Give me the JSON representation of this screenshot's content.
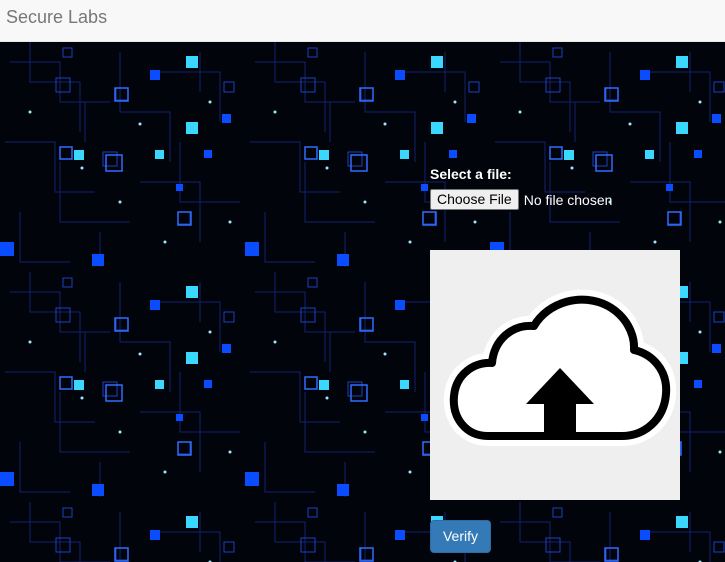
{
  "navbar": {
    "brand": "Secure Labs"
  },
  "background": {
    "name": "circuit-board-background",
    "colors": [
      "#02040c",
      "#0a4cff",
      "#3ad8ff",
      "#1a2a80"
    ]
  },
  "upload": {
    "label": "Select a file:",
    "choose_button_label": "Choose File",
    "file_status": "No file chosen"
  },
  "preview": {
    "icon": "cloud-upload-icon",
    "background_color": "#efefef"
  },
  "verify": {
    "label": "Verify",
    "color": "#337ab7"
  }
}
